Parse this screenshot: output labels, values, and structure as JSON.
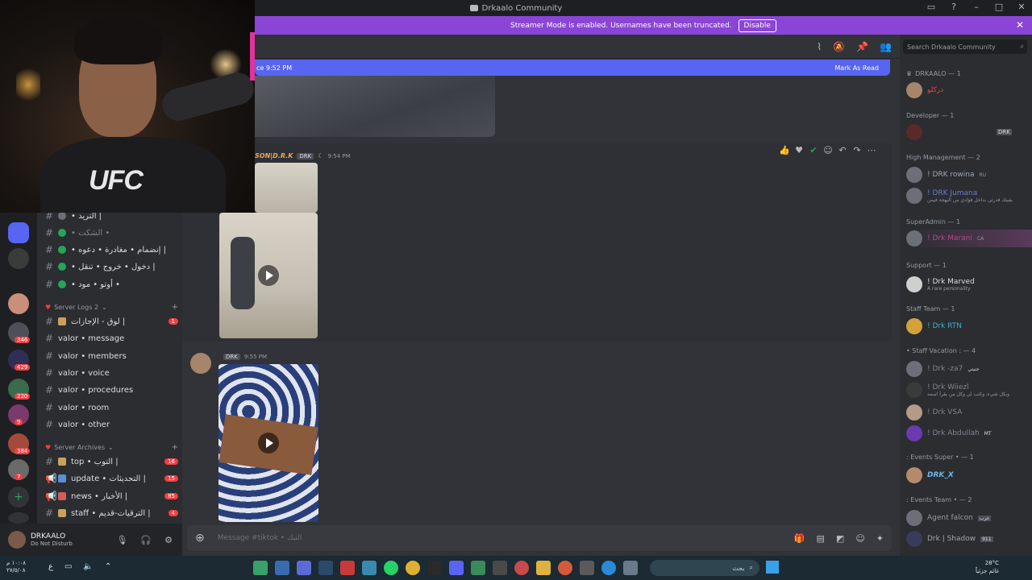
{
  "window": {
    "title": "Drkaalo Community"
  },
  "banner": {
    "text": "Streamer Mode is enabled. Usernames have been truncated.",
    "disable_label": "Disable"
  },
  "channels": [
    {
      "name": "• التريد |",
      "type": "text"
    },
    {
      "name": "• الشكت •",
      "type": "text"
    },
    {
      "name": "• إنضمام • مغادرة • دعوه |",
      "type": "text"
    },
    {
      "name": "• دخول • خروج • تنقل |",
      "type": "text"
    },
    {
      "name": "• أوتو • مود •",
      "type": "text"
    }
  ],
  "server_logs": {
    "label": "Server Logs 2",
    "items": [
      {
        "name": "لوق - الإجازات |",
        "count": "1"
      },
      {
        "name": "valor • message"
      },
      {
        "name": "valor • members"
      },
      {
        "name": "valor • voice"
      },
      {
        "name": "valor • procedures"
      },
      {
        "name": "valor • room"
      },
      {
        "name": "valor • other"
      }
    ]
  },
  "server_archives": {
    "label": "Server Archives",
    "items": [
      {
        "name": "top • التوب |",
        "count": "16"
      },
      {
        "name": "update • التحديثات |",
        "count": "15"
      },
      {
        "name": "news • الأخبار |",
        "count": "85"
      },
      {
        "name": "staff • الترقيات-قديم |",
        "count": "4"
      }
    ]
  },
  "rail_badges": [
    "346",
    "429",
    "220",
    "9",
    "384",
    "7"
  ],
  "user": {
    "name": "DRKAALO",
    "status": "Do Not Disturb"
  },
  "newbar": {
    "left": "ce 9:52 PM",
    "right": "Mark As Read"
  },
  "messages": [
    {
      "author": "SON|D.R.K",
      "tag": "DRK",
      "time": "9:54 PM"
    },
    {
      "author": "",
      "tag": "DRK",
      "time": "9:55 PM"
    }
  ],
  "input": {
    "placeholder": "Message #tiktok • التيك"
  },
  "search": {
    "placeholder": "Search Drkaalo Community"
  },
  "member_groups": [
    {
      "role": "DRKAALO — 1",
      "members": [
        {
          "name": "دركلو"
        }
      ]
    },
    {
      "role": "Developer — 1",
      "members": [
        {
          "name": "",
          "tag": "DRK"
        }
      ]
    },
    {
      "role": "High Management — 2",
      "members": [
        {
          "name": "! DRK rowina",
          "tag": "RU"
        },
        {
          "name": "! DRK Jumana",
          "sub": "يقينك قدرتي بداخل فؤادي من البهجة فيمن"
        }
      ]
    },
    {
      "role": "SuperAdmin — 1",
      "members": [
        {
          "name": "! Drk Marani",
          "tag": "CA"
        }
      ]
    },
    {
      "role": "Support — 1",
      "members": [
        {
          "name": "! Drk Marved",
          "sub": "A rare personality"
        }
      ]
    },
    {
      "role": "Staff Team — 1",
      "members": [
        {
          "name": "! Drk RTN"
        }
      ]
    },
    {
      "role": "• Staff Vacation : — 4",
      "members": [
        {
          "name": "! Drk -za7",
          "tag": "جنيتي"
        },
        {
          "name": "! Drk Wiiezl",
          "sub": "وبكل شيء، وكتب لي وكل من يقرأ اسمه"
        },
        {
          "name": "! Drk VSA"
        },
        {
          "name": "! Drk Abdullah",
          "tag": "MT"
        }
      ]
    },
    {
      "role": ": Events Super • — 1",
      "members": [
        {
          "name": "DRK_X"
        }
      ]
    },
    {
      "role": ": Events Team • — 2",
      "members": [
        {
          "name": "Agent falcon",
          "tag": "عرب"
        },
        {
          "name": "Drk | Shadow",
          "tag": "911"
        }
      ]
    }
  ],
  "taskbar": {
    "time": "١٠:٠٨ م",
    "date": "٢٧/٥/٠٨",
    "lang": "ع",
    "search": "بحث",
    "weather_temp": "28°C",
    "weather_desc": "غائم جزئياً"
  },
  "colors": {
    "accent": "#5865f2",
    "banner": "#8b45d6",
    "dnd": "#f23f43"
  }
}
